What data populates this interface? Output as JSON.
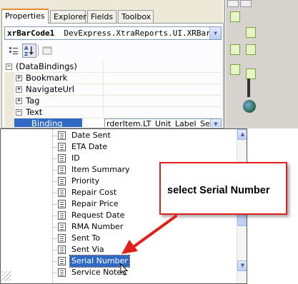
{
  "tabs": [
    "Properties",
    "Explorer",
    "Fields",
    "Toolbox"
  ],
  "object_selector": {
    "name": "xrBarCode1",
    "type": "DevExpress.XtraReports.UI.XRBarCode"
  },
  "property_grid": {
    "rows": [
      {
        "label": "(DataBindings)",
        "expander": "⊟",
        "level": 0
      },
      {
        "label": "Bookmark",
        "expander": "⊞",
        "level": 1
      },
      {
        "label": "NavigateUrl",
        "expander": "⊞",
        "level": 1
      },
      {
        "label": "Tag",
        "expander": "⊞",
        "level": 1
      },
      {
        "label": "Text",
        "expander": "⊟",
        "level": 1
      },
      {
        "label": "Binding",
        "value": "rderItem.LT_Unit_Label_Serial",
        "selected": true,
        "level": 2
      }
    ]
  },
  "field_list": {
    "items": [
      "Date Sent",
      "ETA Date",
      "ID",
      "Item Summary",
      "Priority",
      "Repair Cost",
      "Repair Price",
      "Request Date",
      "RMA Number",
      "Sent To",
      "Sent Via",
      "Serial Number",
      "Service Notes"
    ],
    "selected": "Serial Number"
  },
  "callout": {
    "text": "select Serial Number",
    "color": "#e0201b"
  },
  "colors": {
    "selection": "#316ac5",
    "active_tab_accent": "#e68b2c",
    "panel_background": "#ece9d8"
  }
}
